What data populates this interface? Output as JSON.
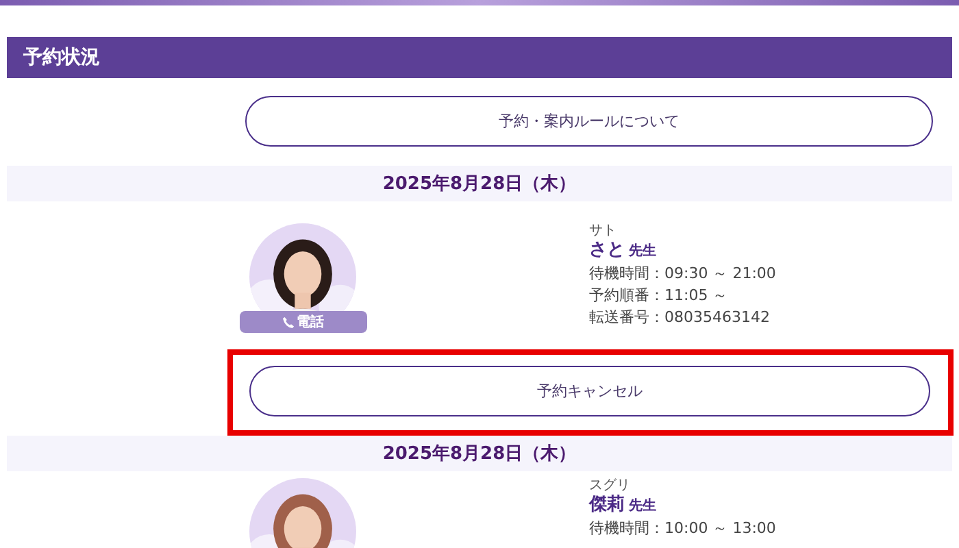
{
  "section_title": "予約状況",
  "rules_button": "予約・案内ルールについて",
  "reservations": [
    {
      "date": "2025年8月28日（木）",
      "kana": "サト",
      "name": "さと",
      "honorific": "先生",
      "badge": "電話",
      "details": [
        "待機時間：09:30 ～ 21:00",
        "予約順番：11:05 ～",
        "転送番号：08035463142"
      ],
      "action": "予約キャンセル",
      "highlighted": true
    },
    {
      "date": "2025年8月28日（木）",
      "kana": "スグリ",
      "name": "傑莉",
      "honorific": "先生",
      "details": [
        "待機時間：10:00 ～ 13:00"
      ]
    }
  ]
}
